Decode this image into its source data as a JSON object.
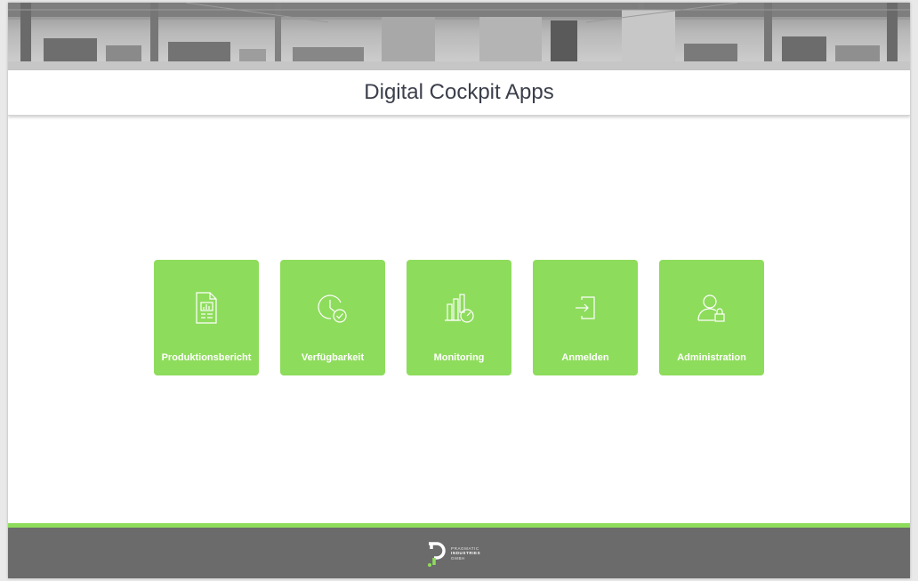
{
  "header": {
    "title": "Digital Cockpit Apps"
  },
  "apps": [
    {
      "label": "Produktionsbericht",
      "icon": "report-chart-icon"
    },
    {
      "label": "Verfügbarkeit",
      "icon": "clock-check-icon"
    },
    {
      "label": "Monitoring",
      "icon": "bars-gauge-icon"
    },
    {
      "label": "Anmelden",
      "icon": "login-arrow-icon"
    },
    {
      "label": "Administration",
      "icon": "user-lock-icon"
    }
  ],
  "footer": {
    "logo_line1": "PRAGMATIC",
    "logo_line2": "INDUSTRIES",
    "logo_line3": "GMBH"
  },
  "colors": {
    "accent": "#8edc5c",
    "footer": "#6b6b6b",
    "title_text": "#3b3f4b"
  }
}
